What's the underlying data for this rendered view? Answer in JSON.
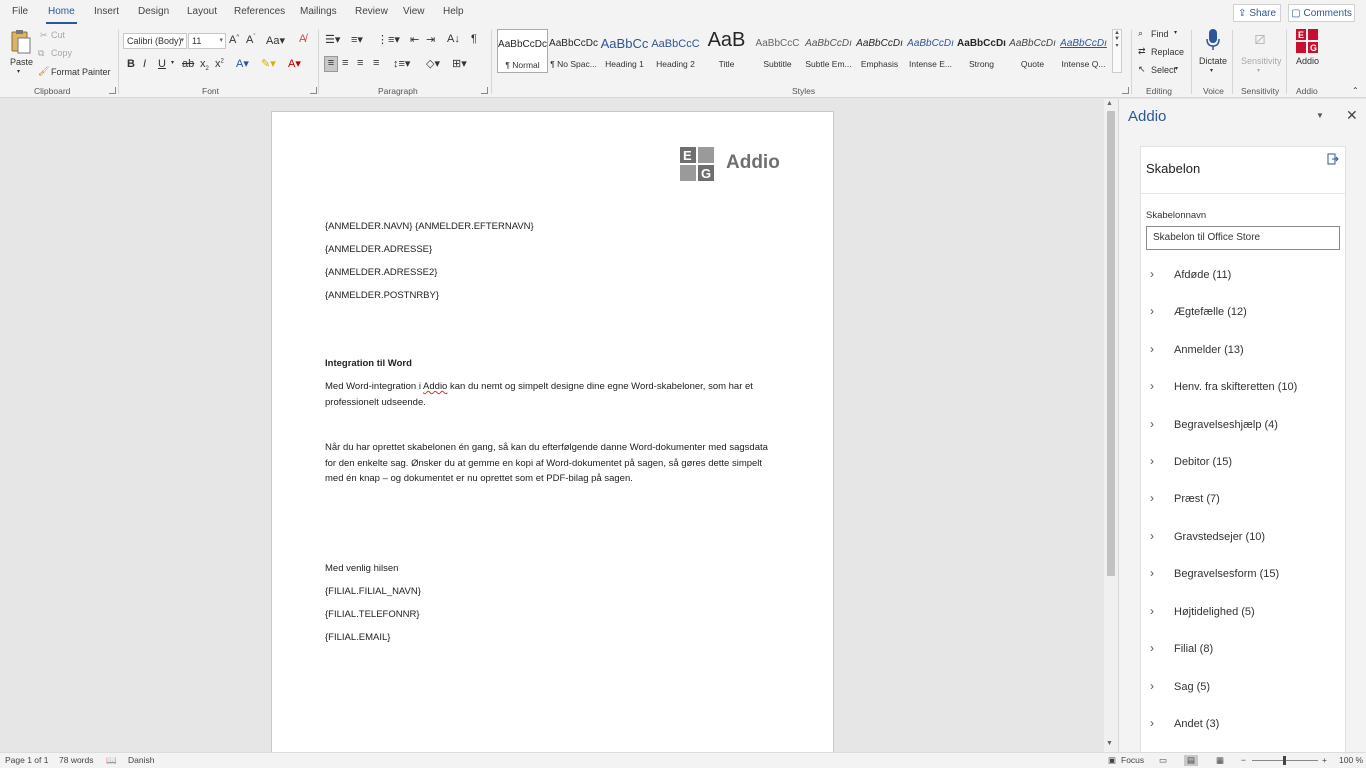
{
  "menu": {
    "tabs": [
      "File",
      "Home",
      "Insert",
      "Design",
      "Layout",
      "References",
      "Mailings",
      "Review",
      "View",
      "Help"
    ],
    "active": "Home",
    "share_label": "Share",
    "comments_label": "Comments"
  },
  "ribbon": {
    "clipboard": {
      "paste": "Paste",
      "cut": "Cut",
      "copy": "Copy",
      "format_painter": "Format Painter",
      "group": "Clipboard"
    },
    "font": {
      "name": "Calibri (Body)",
      "size": "11",
      "group": "Font"
    },
    "paragraph": {
      "group": "Paragraph"
    },
    "styles": {
      "group": "Styles",
      "items": [
        {
          "sample": "AaBbCcDc",
          "name": "¶ Normal"
        },
        {
          "sample": "AaBbCcDc",
          "name": "¶ No Spac..."
        },
        {
          "sample": "AaBbCc",
          "name": "Heading 1"
        },
        {
          "sample": "AaBbCcC",
          "name": "Heading 2"
        },
        {
          "sample": "AaB",
          "name": "Title"
        },
        {
          "sample": "AaBbCcC",
          "name": "Subtitle"
        },
        {
          "sample": "AaBbCcDı",
          "name": "Subtle Em..."
        },
        {
          "sample": "AaBbCcDı",
          "name": "Emphasis"
        },
        {
          "sample": "AaBbCcDı",
          "name": "Intense E..."
        },
        {
          "sample": "AaBbCcDı",
          "name": "Strong"
        },
        {
          "sample": "AaBbCcDı",
          "name": "Quote"
        },
        {
          "sample": "AaBbCcDı",
          "name": "Intense Q..."
        }
      ]
    },
    "editing": {
      "find": "Find",
      "replace": "Replace",
      "select": "Select",
      "group": "Editing"
    },
    "voice": {
      "dictate": "Dictate",
      "group": "Voice"
    },
    "sensitivity": {
      "label": "Sensitivity",
      "group": "Sensitivity"
    },
    "addio": {
      "label": "Addio",
      "group": "Addio"
    }
  },
  "document": {
    "logo_text": "Addio",
    "lines": [
      "{ANMELDER.NAVN} {ANMELDER.EFTERNAVN}",
      "{ANMELDER.ADRESSE}",
      "{ANMELDER.ADRESSE2}",
      "{ANMELDER.POSTNRBY}"
    ],
    "heading": "Integration til Word",
    "para1_a": "Med Word-integration i ",
    "para1_word": "Addio",
    "para1_b": " kan du nemt og simpelt designe dine egne Word-skabeloner, som har et",
    "para1_c": "professionelt udseende.",
    "para2_a": "Når du har oprettet skabelonen én gang, så kan du efterfølgende danne Word-dokumenter med sagsdata",
    "para2_b": "for den enkelte sag. Ønsker du at gemme en kopi af Word-dokumentet på sagen, så gøres dette simpelt",
    "para2_c": "med én knap – og dokumentet er nu oprettet som et PDF-bilag på sagen.",
    "closing": "Med venlig hilsen",
    "footer_lines": [
      "{FILIAL.FILIAL_NAVN}",
      "{FILIAL.TELEFONNR}",
      "{FILIAL.EMAIL}"
    ]
  },
  "pane": {
    "title": "Addio",
    "card_title": "Skabelon",
    "field_label": "Skabelonnavn",
    "field_value": "Skabelon til Office Store",
    "categories": [
      "Afdøde (11)",
      "Ægtefælle (12)",
      "Anmelder (13)",
      "Henv. fra skifteretten (10)",
      "Begravelseshjælp (4)",
      "Debitor (15)",
      "Præst (7)",
      "Gravstedsejer (10)",
      "Begravelsesform (15)",
      "Højtidelighed (5)",
      "Filial (8)",
      "Sag (5)",
      "Andet (3)"
    ]
  },
  "status": {
    "page": "Page 1 of 1",
    "words": "78 words",
    "language": "Danish",
    "focus": "Focus",
    "zoom": "100 %"
  },
  "colors": {
    "accent": "#2b579a",
    "addio_red": "#c8102e"
  }
}
